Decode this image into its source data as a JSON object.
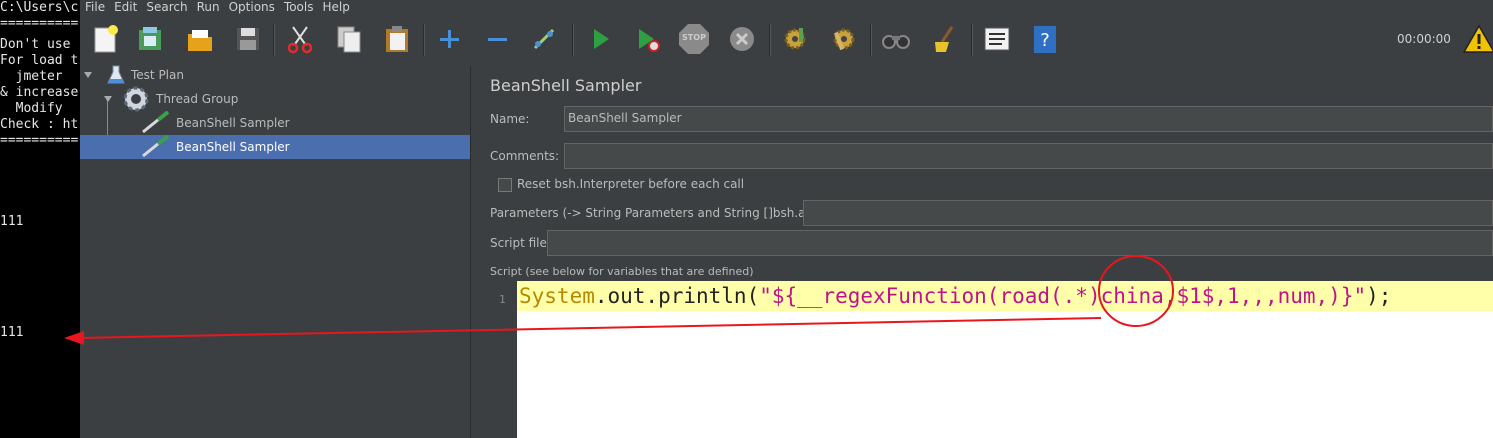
{
  "console": {
    "lines": [
      "C:\\Users\\c",
      "==========",
      "Don't use ",
      "For load t",
      "  jmeter ",
      "& increase",
      "  Modify ",
      "Check : ht",
      "==========",
      "111",
      "111"
    ]
  },
  "menu": [
    "File",
    "Edit",
    "Search",
    "Run",
    "Options",
    "Tools",
    "Help"
  ],
  "toolbar": {
    "icons": [
      "new-icon",
      "templates-icon",
      "open-icon",
      "save-icon",
      "cut-icon",
      "copy-icon",
      "paste-icon",
      "expand-icon",
      "collapse-icon",
      "toggle-icon",
      "start-icon",
      "start-no-pause-icon",
      "stop-icon",
      "shutdown-icon",
      "clear-icon",
      "clear-all-icon",
      "search-icon",
      "reset-search-icon",
      "function-helper-icon",
      "help-icon"
    ],
    "timer": "00:00:00",
    "stop_label": "STOP"
  },
  "tree": {
    "items": [
      {
        "label": "Test Plan"
      },
      {
        "label": "Thread Group"
      },
      {
        "label": "BeanShell Sampler"
      },
      {
        "label": "BeanShell Sampler"
      }
    ]
  },
  "panel": {
    "title": "BeanShell Sampler",
    "name_label": "Name:",
    "name_value": "BeanShell Sampler",
    "comments_label": "Comments:",
    "comments_value": "",
    "reset_label": "Reset bsh.Interpreter before each call",
    "params_label": "Parameters (-> String Parameters and String []bsh.args)",
    "params_value": "",
    "script_file_label": "Script file",
    "script_file_value": "",
    "script_label": "Script (see below for variables that are defined)",
    "line_number": "1",
    "code": {
      "part1": "System",
      "part2": ".out.println(",
      "part3": "\"${__regexFunction(road(.*)china,$1$,1,,,num,)}\"",
      "part4": ");"
    }
  },
  "colors": {
    "annotation": "#e8161e",
    "selection": "#4b6eaf",
    "code_keyword": "#b58900",
    "code_string": "#c0138b",
    "code_highlight": "#ffffaa"
  }
}
